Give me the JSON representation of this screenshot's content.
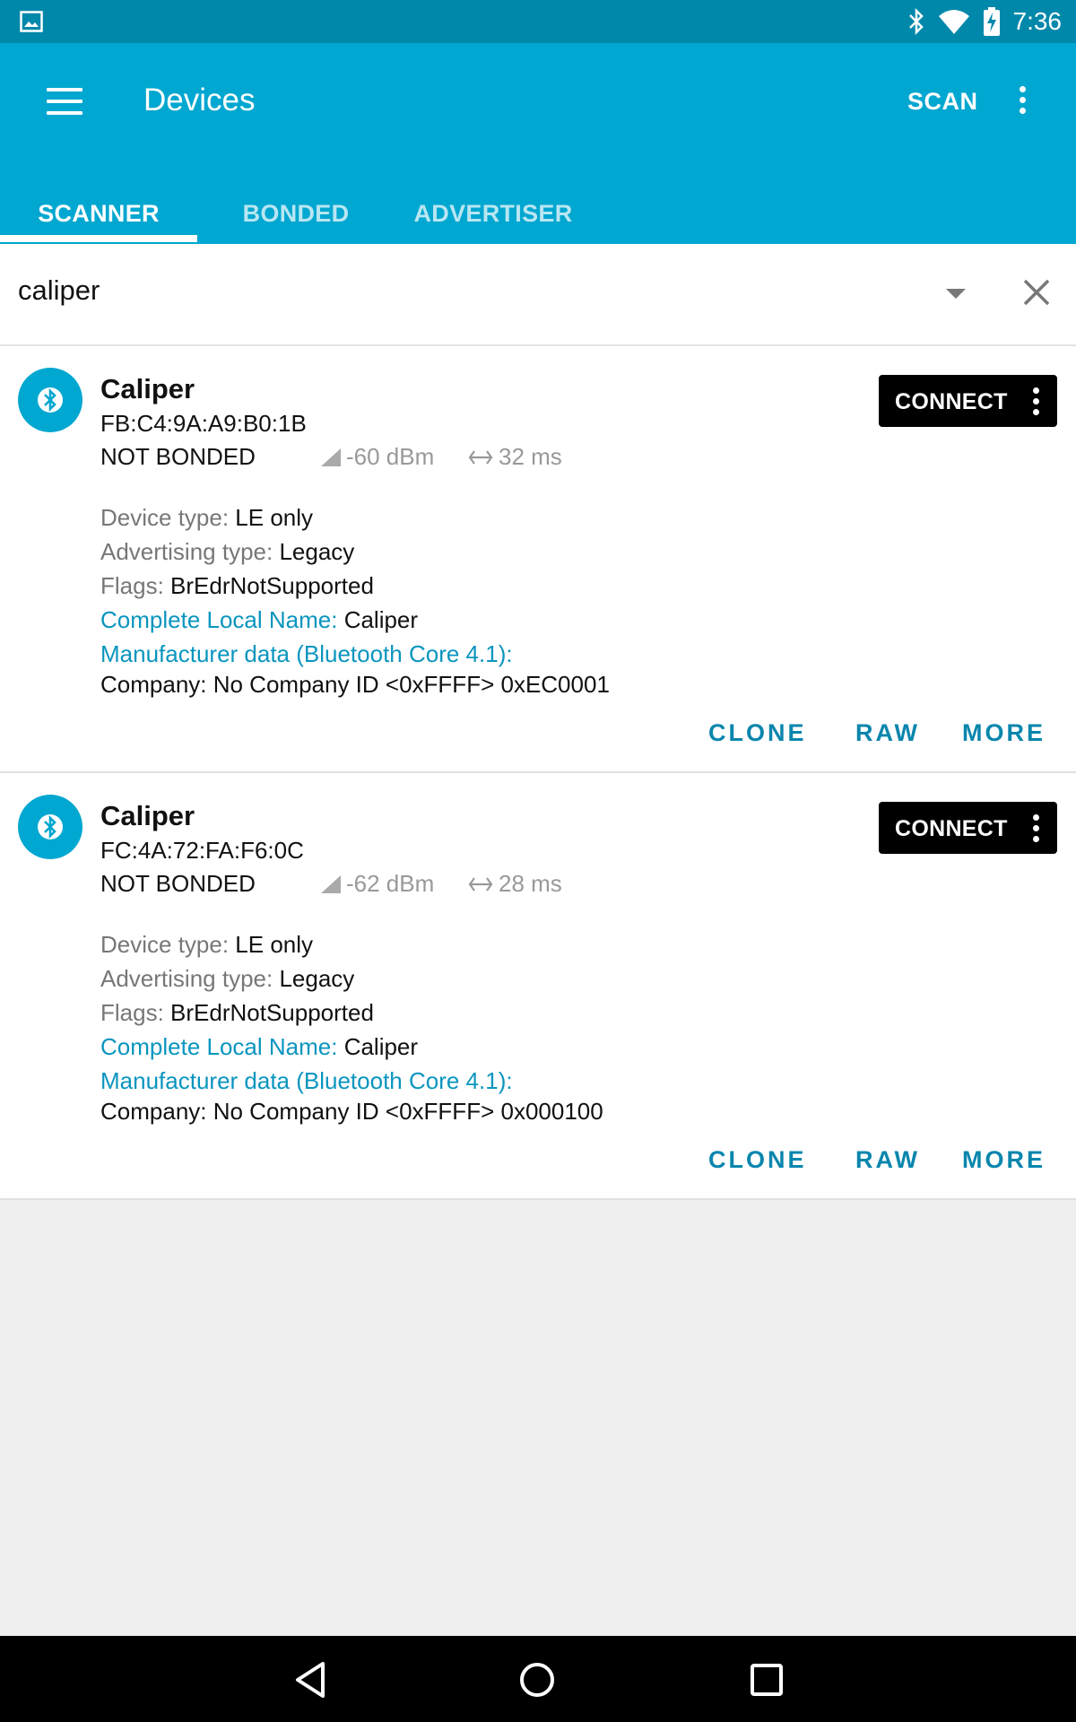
{
  "status_bar": {
    "time": "7:36",
    "icons": [
      "image-icon",
      "bluetooth-icon",
      "wifi-icon",
      "battery-charging-icon"
    ]
  },
  "app_bar": {
    "title": "Devices",
    "scan_label": "SCAN",
    "color": "#00a7d0"
  },
  "tabs": [
    {
      "label": "SCANNER",
      "active": true
    },
    {
      "label": "BONDED",
      "active": false
    },
    {
      "label": "ADVERTISER",
      "active": false
    }
  ],
  "filter": {
    "value": "caliper"
  },
  "devices": [
    {
      "name": "Caliper",
      "address": "FB:C4:9A:A9:B0:1B",
      "bond_state": "NOT BONDED",
      "rssi": "-60 dBm",
      "interval": "32 ms",
      "connect_label": "CONNECT",
      "device_type_label": "Device type: ",
      "device_type": "LE only",
      "adv_type_label": "Advertising type: ",
      "adv_type": "Legacy",
      "flags_label": "Flags: ",
      "flags": "BrEdrNotSupported",
      "local_name_label": "Complete Local Name: ",
      "local_name": "Caliper",
      "manufacturer_label": "Manufacturer data (Bluetooth Core 4.1):",
      "company": "Company: No Company ID <0xFFFF> 0xEC0001",
      "actions": [
        "CLONE",
        "RAW",
        "MORE"
      ]
    },
    {
      "name": "Caliper",
      "address": "FC:4A:72:FA:F6:0C",
      "bond_state": "NOT BONDED",
      "rssi": "-62 dBm",
      "interval": "28 ms",
      "connect_label": "CONNECT",
      "device_type_label": "Device type: ",
      "device_type": "LE only",
      "adv_type_label": "Advertising type: ",
      "adv_type": "Legacy",
      "flags_label": "Flags: ",
      "flags": "BrEdrNotSupported",
      "local_name_label": "Complete Local Name: ",
      "local_name": "Caliper",
      "manufacturer_label": "Manufacturer data (Bluetooth Core 4.1):",
      "company": "Company: No Company ID <0xFFFF> 0x000100",
      "actions": [
        "CLONE",
        "RAW",
        "MORE"
      ]
    }
  ],
  "nav_bar": {
    "buttons": [
      "back-icon",
      "home-icon",
      "recents-icon"
    ]
  }
}
